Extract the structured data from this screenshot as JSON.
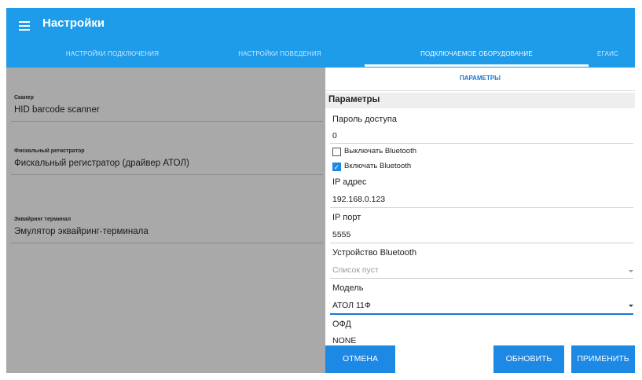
{
  "app": {
    "title": "Настройки"
  },
  "tabs": [
    {
      "label": "НАСТРОЙКИ ПОДКЛЮЧЕНИЯ"
    },
    {
      "label": "НАСТРОЙКИ ПОВЕДЕНИЯ"
    },
    {
      "label": "ПОДКЛЮЧАЕМОЕ ОБОРУДОВАНИЕ"
    },
    {
      "label": "ЕГАИС"
    }
  ],
  "devices": [
    {
      "label": "Сканер",
      "value": "HID barcode scanner"
    },
    {
      "label": "Фискальный регистратор",
      "value": "Фискальный регистратор (драйвер АТОЛ)"
    },
    {
      "label": "Эквайринг терминал",
      "value": "Эмулятор эквайринг-терминала"
    }
  ],
  "panel": {
    "subtab": "ПАРАМЕТРЫ",
    "section_title": "Параметры",
    "password": {
      "label": "Пароль доступа",
      "value": "0"
    },
    "checkboxes": [
      {
        "label": "Выключать Bluetooth",
        "checked": false,
        "mark": ""
      },
      {
        "label": "Включать Bluetooth",
        "checked": true,
        "mark": "✓"
      }
    ],
    "ip_address": {
      "label": "IP адрес",
      "value": "192.168.0.123"
    },
    "ip_port": {
      "label": "IP порт",
      "value": "5555"
    },
    "bt_device": {
      "label": "Устройство Bluetooth",
      "value": "Список пуст"
    },
    "model": {
      "label": "Модель",
      "value": "АТОЛ 11Ф"
    },
    "ofd": {
      "label": "ОФД",
      "value": "NONE"
    }
  },
  "buttons": {
    "cancel": "ОТМЕНА",
    "refresh": "ОБНОВИТЬ",
    "apply": "ПРИМЕНИТЬ"
  },
  "colors": {
    "primary": "#1e9be9",
    "button": "#1e88e5",
    "accent": "#1976d2"
  }
}
